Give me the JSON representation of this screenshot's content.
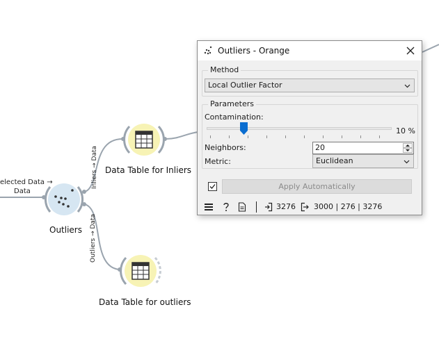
{
  "canvas": {
    "nodes": [
      {
        "label": "Outliers"
      },
      {
        "label": "Data Table for Inliers"
      },
      {
        "label": "Data Table for outliers"
      }
    ],
    "links": {
      "left_label_line1": "elected Data →",
      "left_label_line2": "Data",
      "inliers_label": "Inliers → Data",
      "outliers_label": "Outliers → Data"
    }
  },
  "dialog": {
    "title": "Outliers - Orange",
    "method": {
      "group_title": "Method",
      "selected": "Local Outlier Factor"
    },
    "parameters": {
      "group_title": "Parameters",
      "contamination_label": "Contamination:",
      "contamination_value": 10,
      "contamination_text": "10 %",
      "neighbors_label": "Neighbors:",
      "neighbors_value": "20",
      "metric_label": "Metric:",
      "metric_selected": "Euclidean"
    },
    "apply": {
      "label": "Apply Automatically",
      "checked": true
    },
    "status": {
      "input_count": "3276",
      "output_counts": "3000 | 276 | 3276"
    }
  },
  "colors": {
    "node_fill": "#f7f3b5",
    "node_arc": "#9aa4ae",
    "outliers_node_fill": "#d6e6f2",
    "slider_handle": "#0a6dd0",
    "link": "#9aa4ae"
  }
}
